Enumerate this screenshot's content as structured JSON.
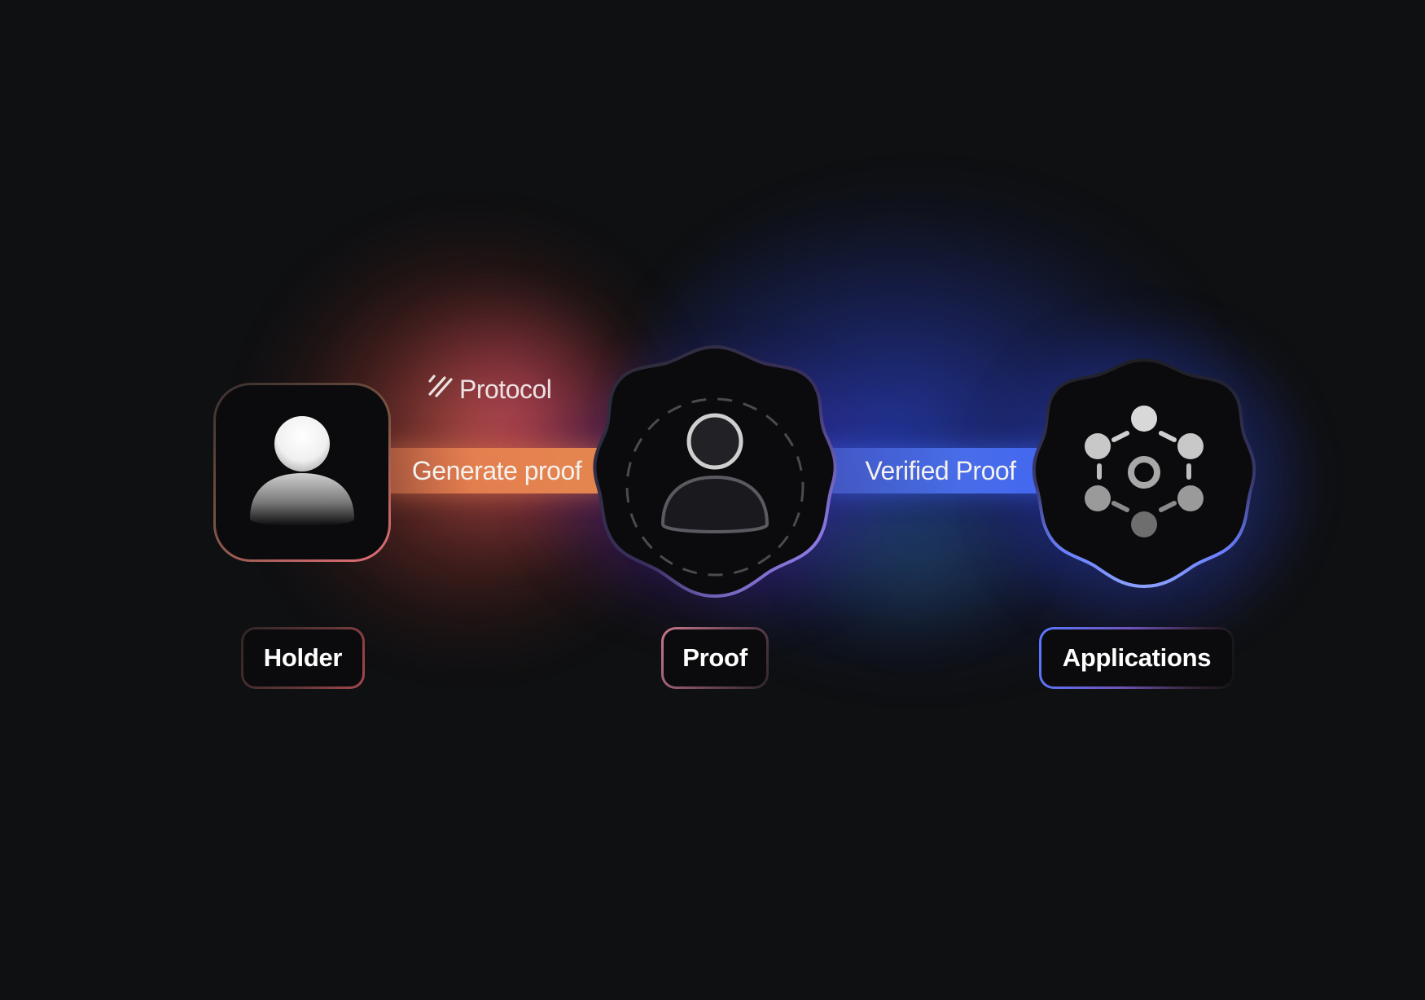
{
  "protocol": {
    "label": "Protocol",
    "icon": "slash-logo-icon"
  },
  "connectors": {
    "generate": "Generate proof",
    "verified": "Verified Proof"
  },
  "nodes": {
    "holder": {
      "label": "Holder",
      "icon": "user-avatar-icon"
    },
    "proof": {
      "label": "Proof",
      "icon": "user-outline-icon"
    },
    "applications": {
      "label": "Applications",
      "icon": "network-nodes-icon"
    }
  },
  "colors": {
    "background": "#0f1012",
    "orange_accent": "#e8824f",
    "blue_accent": "#4f73ff",
    "purple_glow": "#7828dc"
  }
}
